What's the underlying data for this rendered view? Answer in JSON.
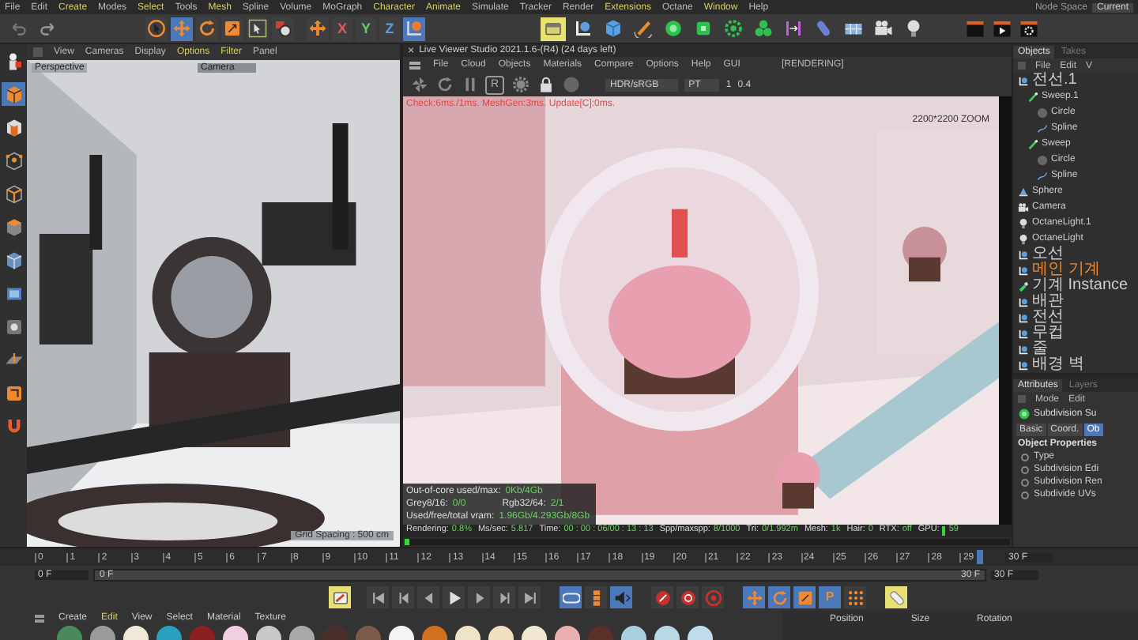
{
  "menu_bar": {
    "items": [
      {
        "label": "File",
        "highlighted": false
      },
      {
        "label": "Edit",
        "highlighted": false
      },
      {
        "label": "Create",
        "highlighted": true
      },
      {
        "label": "Modes",
        "highlighted": false
      },
      {
        "label": "Select",
        "highlighted": true
      },
      {
        "label": "Tools",
        "highlighted": false
      },
      {
        "label": "Mesh",
        "highlighted": true
      },
      {
        "label": "Spline",
        "highlighted": false
      },
      {
        "label": "Volume",
        "highlighted": false
      },
      {
        "label": "MoGraph",
        "highlighted": false
      },
      {
        "label": "Character",
        "highlighted": true
      },
      {
        "label": "Animate",
        "highlighted": true
      },
      {
        "label": "Simulate",
        "highlighted": false
      },
      {
        "label": "Tracker",
        "highlighted": false
      },
      {
        "label": "Render",
        "highlighted": false
      },
      {
        "label": "Extensions",
        "highlighted": true
      },
      {
        "label": "Octane",
        "highlighted": false
      },
      {
        "label": "Window",
        "highlighted": true
      },
      {
        "label": "Help",
        "highlighted": false
      }
    ],
    "node_space_label": "Node Space",
    "node_space_value": "Current"
  },
  "toolbar": {
    "history": [
      {
        "kind": "undo"
      },
      {
        "kind": "redo"
      }
    ],
    "tools": [
      {
        "kind": "cursor",
        "selected": false
      },
      {
        "kind": "move",
        "selected": true
      },
      {
        "kind": "rotate",
        "selected": false
      },
      {
        "kind": "scale",
        "selected": false
      },
      {
        "kind": "select-box",
        "selected": false
      },
      {
        "kind": "render-object",
        "selected": false
      },
      {
        "kind": "axis-move",
        "selected": false
      },
      {
        "kind": "axis",
        "label": "X",
        "color": "#e05a5a",
        "selected": false
      },
      {
        "kind": "axis",
        "label": "Y",
        "color": "#5ad070",
        "selected": false
      },
      {
        "kind": "axis",
        "label": "Z",
        "color": "#5a9ae0",
        "selected": false
      },
      {
        "kind": "coord",
        "selected": true
      }
    ],
    "objects": [
      {
        "kind": "view-toggle",
        "selected": true
      },
      {
        "kind": "null",
        "selected": false
      },
      {
        "kind": "cube",
        "selected": false
      },
      {
        "kind": "pen",
        "selected": false
      },
      {
        "kind": "subdiv",
        "selected": false
      },
      {
        "kind": "extrude",
        "selected": false
      },
      {
        "kind": "cloner",
        "selected": false
      },
      {
        "kind": "array",
        "selected": false
      },
      {
        "kind": "bend",
        "selected": false
      },
      {
        "kind": "capsule",
        "selected": false
      },
      {
        "kind": "floor",
        "selected": false
      },
      {
        "kind": "camera",
        "selected": false
      },
      {
        "kind": "light",
        "selected": false
      }
    ],
    "render": [
      {
        "kind": "clap"
      },
      {
        "kind": "clap-play"
      },
      {
        "kind": "clap-gear"
      }
    ]
  },
  "left_palette": [
    {
      "kind": "figure",
      "selected": false
    },
    {
      "kind": "model",
      "selected": true
    },
    {
      "kind": "checker",
      "selected": false
    },
    {
      "kind": "points",
      "selected": false
    },
    {
      "kind": "edges",
      "selected": false
    },
    {
      "kind": "polys",
      "selected": false
    },
    {
      "kind": "uv",
      "selected": false
    },
    {
      "kind": "poly-cube",
      "selected": false
    },
    {
      "kind": "solo",
      "selected": false
    },
    {
      "kind": "workplane",
      "selected": false
    },
    {
      "kind": "snap",
      "selected": false
    },
    {
      "kind": "magnet",
      "selected": false
    }
  ],
  "viewport": {
    "menu": [
      {
        "label": "View",
        "highlighted": false
      },
      {
        "label": "Cameras",
        "highlighted": false
      },
      {
        "label": "Display",
        "highlighted": false
      },
      {
        "label": "Options",
        "highlighted": true
      },
      {
        "label": "Filter",
        "highlighted": true
      },
      {
        "label": "Panel",
        "highlighted": false
      }
    ],
    "view_name": "Perspective",
    "camera": "Camera",
    "grid_spacing": "Grid Spacing : 500 cm"
  },
  "live_viewer": {
    "close_glyph": "×",
    "title": "Live Viewer Studio 2021.1.6-(R4) (24 days left)",
    "menu": [
      "File",
      "Cloud",
      "Objects",
      "Materials",
      "Compare",
      "Options",
      "Help",
      "GUI"
    ],
    "state": "[RENDERING]",
    "tools": [
      {
        "kind": "pinwheel"
      },
      {
        "kind": "refresh"
      },
      {
        "kind": "pause"
      },
      {
        "kind": "letter",
        "label": "R"
      },
      {
        "kind": "gear"
      },
      {
        "kind": "lock"
      },
      {
        "kind": "circle"
      }
    ],
    "color_space": "HDR/sRGB",
    "kernel": "PT",
    "value_1": "1",
    "value_2": "0.4",
    "stats": "Check:6ms./1ms. MeshGen:3ms. Update[C]:0ms.",
    "resolution": "2200*2200 ZOOM",
    "memory": [
      {
        "label": "Out-of-core used/max:",
        "value": "0Kb/4Gb"
      },
      {
        "label": "Grey8/16:",
        "value": "0/0",
        "label_2": "Rgb32/64:",
        "value_2": "2/1"
      },
      {
        "label": "Used/free/total vram:",
        "value": "1.96Gb/4.293Gb/8Gb"
      }
    ],
    "status": [
      {
        "label": "Rendering:",
        "value": "0.8%"
      },
      {
        "label": "Ms/sec:",
        "value": "5.817"
      },
      {
        "label": "Time:",
        "value": "00 : 00 : 06/00 : 13 : 13"
      },
      {
        "label": "Spp/maxspp:",
        "value": "8/1000"
      },
      {
        "label": "Tri:",
        "value": "0/1.992m"
      },
      {
        "label": "Mesh:",
        "value": "1k"
      },
      {
        "label": "Hair:",
        "value": "0"
      },
      {
        "label": "RTX:",
        "value": "off"
      },
      {
        "label": "GPU:",
        "value": "59"
      }
    ],
    "progress": {
      "level": 0.008
    }
  },
  "objects_panel": {
    "tabs": [
      {
        "label": "Objects",
        "selected": true
      },
      {
        "label": "Takes",
        "selected": false
      }
    ],
    "menu": [
      "File",
      "Edit",
      "V"
    ],
    "tree": [
      {
        "label": "전선.1",
        "kind": "null",
        "selected": false,
        "children": [
          {
            "label": "Sweep.1",
            "kind": "sweep",
            "selected": false,
            "children": [
              {
                "label": "Circle",
                "kind": "circle",
                "selected": false
              },
              {
                "label": "Spline",
                "kind": "spline",
                "selected": false
              }
            ]
          },
          {
            "label": "Sweep",
            "kind": "sweep",
            "selected": false,
            "children": [
              {
                "label": "Circle",
                "kind": "circle",
                "selected": false
              },
              {
                "label": "Spline",
                "kind": "spline",
                "selected": false
              }
            ]
          }
        ]
      },
      {
        "label": "Sphere",
        "kind": "sphere",
        "selected": false
      },
      {
        "label": "Camera",
        "kind": "camera",
        "selected": false
      },
      {
        "label": "OctaneLight.1",
        "kind": "light",
        "selected": false
      },
      {
        "label": "OctaneLight",
        "kind": "light",
        "selected": false
      },
      {
        "label": "오선",
        "kind": "null",
        "selected": false
      },
      {
        "label": "메인 기계",
        "kind": "null",
        "selected": true
      },
      {
        "label": "기계 Instance",
        "kind": "instance",
        "selected": false
      },
      {
        "label": "배관",
        "kind": "null",
        "selected": false
      },
      {
        "label": "전선",
        "kind": "null",
        "selected": false
      },
      {
        "label": "무컵",
        "kind": "null",
        "selected": false
      },
      {
        "label": "줄",
        "kind": "null",
        "selected": false
      },
      {
        "label": "배경 벽",
        "kind": "null",
        "selected": false
      }
    ]
  },
  "attributes_panel": {
    "tabs": [
      {
        "label": "Attributes",
        "selected": true
      },
      {
        "label": "Layers",
        "selected": false
      }
    ],
    "menu": [
      "Mode",
      "Edit"
    ],
    "object_name": "Subdivision Su",
    "sub_tabs": [
      {
        "label": "Basic",
        "selected": false
      },
      {
        "label": "Coord.",
        "selected": false
      },
      {
        "label": "Ob",
        "selected": true
      }
    ],
    "section": "Object Properties",
    "properties": [
      {
        "label": "Type",
        "checked": false
      },
      {
        "label": "Subdivision Edi",
        "checked": false
      },
      {
        "label": "Subdivision Ren",
        "checked": false
      },
      {
        "label": "Subdivide UVs",
        "checked": false
      }
    ]
  },
  "timeline": {
    "ticks": [
      "0",
      "1",
      "2",
      "3",
      "4",
      "5",
      "6",
      "7",
      "8",
      "9",
      "10",
      "11",
      "12",
      "13",
      "14",
      "15",
      "16",
      "17",
      "18",
      "19",
      "20",
      "21",
      "22",
      "23",
      "24",
      "25",
      "26",
      "27",
      "28",
      "29"
    ],
    "end_field": "30 F",
    "start_field": "0 F",
    "range_start": "0 F",
    "range_end": "30 F",
    "range_bar": {
      "level": 1
    },
    "max_field": "30 F"
  },
  "transport": [
    {
      "kind": "key-edit",
      "selected": true
    },
    {
      "kind": "skip-back",
      "selected": false
    },
    {
      "kind": "key-back",
      "selected": false
    },
    {
      "kind": "step-back",
      "selected": false
    },
    {
      "kind": "play",
      "selected": false
    },
    {
      "kind": "step-forward",
      "selected": false
    },
    {
      "kind": "key-forward",
      "selected": false
    },
    {
      "kind": "skip-forward",
      "selected": false
    },
    {
      "kind": "loop",
      "selected": true
    },
    {
      "kind": "tracks",
      "selected": false
    },
    {
      "kind": "sound",
      "selected": true
    },
    {
      "kind": "record",
      "selected": false
    },
    {
      "kind": "auto-key",
      "selected": false
    },
    {
      "kind": "keyframe",
      "selected": false
    },
    {
      "kind": "key-move",
      "selected": true
    },
    {
      "kind": "key-rotate",
      "selected": true
    },
    {
      "kind": "key-scale",
      "selected": true
    },
    {
      "kind": "key-param",
      "label": "P",
      "selected": true
    },
    {
      "kind": "key-grid",
      "selected": false
    },
    {
      "kind": "key-yellow",
      "selected": true
    }
  ],
  "material_bar": {
    "menu": [
      {
        "label": "Create",
        "highlighted": false
      },
      {
        "label": "Edit",
        "highlighted": true
      },
      {
        "label": "View",
        "highlighted": false
      },
      {
        "label": "Select",
        "highlighted": false
      },
      {
        "label": "Material",
        "highlighted": false
      },
      {
        "label": "Texture",
        "highlighted": false
      }
    ],
    "materials": [
      {
        "color": "#4a8a5a"
      },
      {
        "color": "#9a9a9a"
      },
      {
        "color": "#f0e8d8"
      },
      {
        "color": "#2aa0c0"
      },
      {
        "color": "#8a2020"
      },
      {
        "color": "#f0d0e0"
      },
      {
        "color": "#c8c8c8"
      },
      {
        "color": "#a8a8a8"
      },
      {
        "color": "#4a3028"
      },
      {
        "color": "#7a5a48"
      },
      {
        "color": "#f4f4f4"
      },
      {
        "color": "#d07020"
      },
      {
        "color": "#f0e4c8"
      },
      {
        "color": "#eee0c0"
      },
      {
        "color": "#f0e8d0"
      },
      {
        "color": "#e8b0b0"
      },
      {
        "color": "#5a3028"
      },
      {
        "color": "#a8d0e0"
      },
      {
        "color": "#b8d8e4"
      },
      {
        "color": "#c0dce8"
      }
    ]
  },
  "coordinates": {
    "columns": [
      "Position",
      "Size",
      "Rotation"
    ]
  }
}
